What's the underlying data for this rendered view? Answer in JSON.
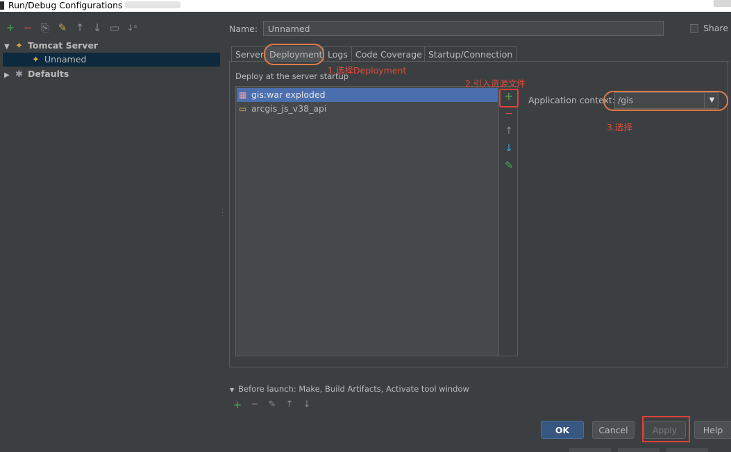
{
  "window": {
    "title": "Run/Debug Configurations"
  },
  "toolbar": {
    "add": "+",
    "remove": "−",
    "copy": "⎘",
    "edit_defaults": "✎",
    "move_up": "↑",
    "move_down": "↓",
    "folder": "▭",
    "sort": "↓ᵃ"
  },
  "tree": {
    "tomcat_server": "Tomcat Server",
    "unnamed": "Unnamed",
    "defaults": "Defaults"
  },
  "name_row": {
    "label": "Name:",
    "value": "Unnamed",
    "share": "Share"
  },
  "tabs": [
    "Server",
    "Deployment",
    "Logs",
    "Code Coverage",
    "Startup/Connection"
  ],
  "deployment": {
    "label": "Deploy at the server startup",
    "items": [
      "gis:war exploded",
      "arcgis_js_v38_api"
    ],
    "context_label": "Application context:",
    "context_value": "/gis"
  },
  "annotations": {
    "step1": "1.选择Deployment",
    "step2": "2.引入资源文件",
    "step3": "3.选择"
  },
  "before_launch": {
    "text": "Before launch: Make, Build Artifacts, Activate tool window"
  },
  "buttons": {
    "ok": "OK",
    "cancel": "Cancel",
    "apply": "Apply",
    "help": "Help"
  },
  "icons": {
    "tomcat": "tomcat-icon",
    "artifact": "war-artifact-icon",
    "folder": "folder-icon"
  },
  "colors": {
    "selection": "#4b6eaf",
    "annotation": "#e04b3a",
    "ok_button": "#365880"
  }
}
